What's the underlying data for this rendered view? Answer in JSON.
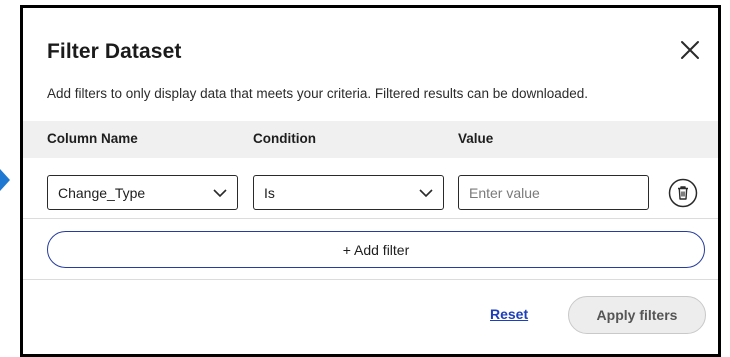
{
  "dialog": {
    "title": "Filter Dataset",
    "subtitle": "Add filters to only display data that meets your criteria. Filtered results can be downloaded.",
    "close_icon": "close-icon"
  },
  "columns": {
    "column_name": "Column Name",
    "condition": "Condition",
    "value": "Value"
  },
  "filters": [
    {
      "column": "Change_Type",
      "condition": "Is",
      "value": "",
      "value_placeholder": "Enter value",
      "delete_icon": "trash-icon"
    }
  ],
  "actions": {
    "add_filter": "+ Add filter",
    "reset": "Reset",
    "apply": "Apply filters"
  },
  "colors": {
    "accent": "#263da0",
    "link": "#1d3fb8",
    "pointer": "#1f78d1"
  }
}
